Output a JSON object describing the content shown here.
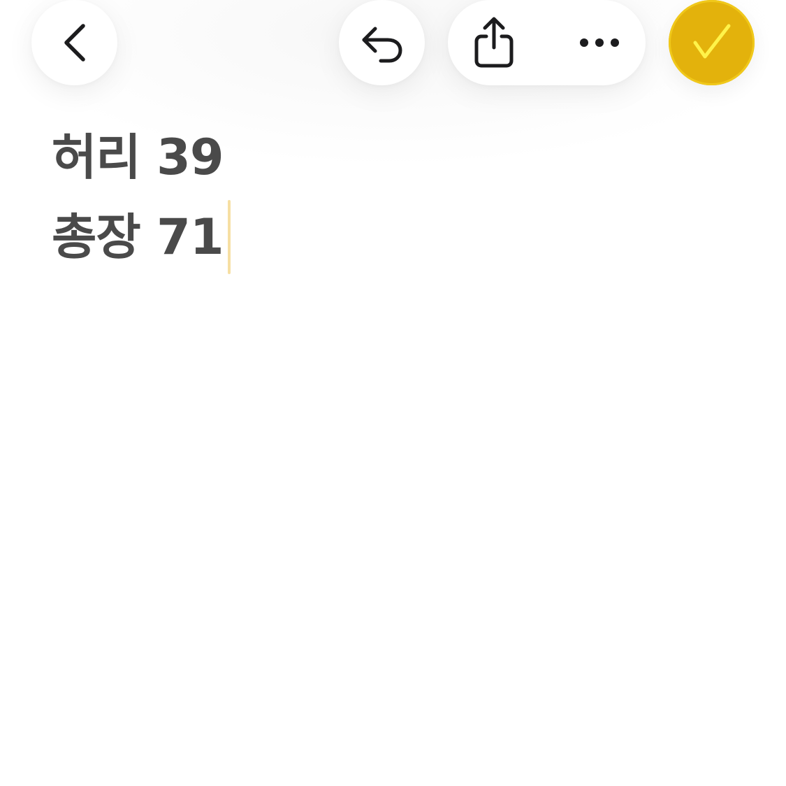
{
  "toolbar": {
    "back_icon": "chevron-left-icon",
    "undo_icon": "undo-arrow-icon",
    "share_icon": "share-icon",
    "more_icon": "ellipsis-icon",
    "done_icon": "checkmark-icon",
    "done_color": "#E3B20C",
    "checkmark_color": "#FFF34A"
  },
  "note": {
    "lines": [
      "허리 39",
      "총장 71"
    ],
    "text_color": "#4a4a4a",
    "caret_color": "#F6DFA3"
  }
}
